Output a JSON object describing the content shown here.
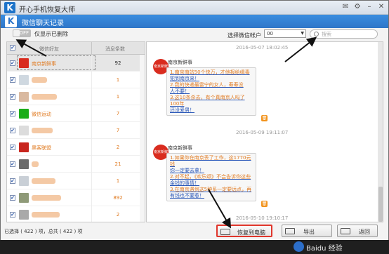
{
  "app": {
    "title": "开心手机恢复大师",
    "logo": "K"
  },
  "window_controls": [
    "chat-icon",
    "settings-icon",
    "minimize-icon",
    "close-icon"
  ],
  "subheader": {
    "title": "微信聊天记录",
    "logo": "K"
  },
  "toolbar": {
    "toggle_label": "OFF",
    "only_deleted_label": "仅显示已删除",
    "account_label": "选择微信帐户",
    "account_value": "00",
    "search_placeholder": "搜索"
  },
  "contacts": {
    "headers": {
      "friend": "微信好友",
      "count": "消息条数"
    },
    "rows": [
      {
        "name": "南京新鲜事",
        "count": "92",
        "avatar_color": "#d92c1f",
        "selected": true
      },
      {
        "name": "",
        "count": "1",
        "avatar_color": "#cfd8e0",
        "selected": false
      },
      {
        "name": "",
        "count": "1",
        "avatar_color": "#d9b9a0",
        "selected": false
      },
      {
        "name": "微信运动",
        "count": "7",
        "avatar_color": "#1aad19",
        "selected": false
      },
      {
        "name": "",
        "count": "7",
        "avatar_color": "#dcdcdc",
        "selected": false
      },
      {
        "name": "黑客联盟",
        "count": "2",
        "avatar_color": "#c8261e",
        "selected": false
      },
      {
        "name": "",
        "count": "21",
        "avatar_color": "#6b6b6b",
        "selected": false
      },
      {
        "name": "",
        "count": "1",
        "avatar_color": "#c9cfd6",
        "selected": false
      },
      {
        "name": "",
        "count": "892",
        "avatar_color": "#8f9a78",
        "selected": false
      },
      {
        "name": "",
        "count": "2",
        "avatar_color": "#a9a9a9",
        "selected": false
      }
    ]
  },
  "messages": [
    {
      "timestamp": "2016-05-07 18:02:45",
      "sender": "南京新鲜事",
      "avatar_label": "南京新鲜事",
      "lines": [
        "1.南京南站50个快万，才他报给缉毒",
        "犯到南京来！",
        "2.我的快递最雷宁的女人，寿寿没",
        "人不要！",
        "3.这10条杀去，有个真南京人吗了100年",
        "还没爱男！"
      ]
    },
    {
      "timestamp": "2016-05-09 19:11:07",
      "sender": "南京新鲜事",
      "avatar_label": "南京新鲜事",
      "lines": [
        "1.如果你在南京丢了工作，这1770元钱",
        "你一定要去拿！",
        "2.对不起，《欢乐颂》不会告诉你这些",
        "金钱的事情！",
        "3.在南京遇到这5种系一定要远点，再",
        "有钱也不要惹！"
      ]
    },
    {
      "timestamp": "2016-05-10 19:10:17"
    }
  ],
  "status": {
    "text": "已选择 ( 422 ) 项，总共 ( 422 ) 项"
  },
  "buttons": {
    "recover": "恢复到电脑",
    "export": "导出",
    "back": "返回"
  },
  "watermark": "Baidu 经验"
}
